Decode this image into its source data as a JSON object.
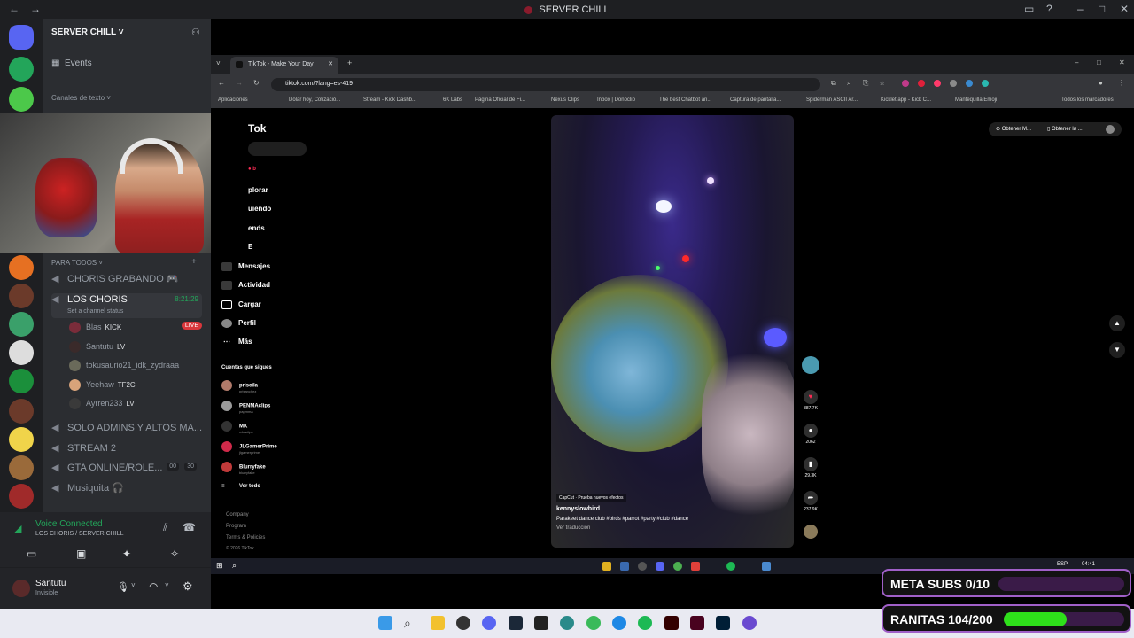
{
  "window": {
    "title": "SERVER CHILL"
  },
  "server": {
    "name": "SERVER CHILL",
    "events_label": "Events",
    "text_channels_label": "Canales de texto",
    "para_todos_label": "PARA TODOS"
  },
  "channels": [
    {
      "name": "CHORIS GRABANDO 🎮",
      "icon": "speaker-icon"
    },
    {
      "name": "LOS CHORIS",
      "icon": "speaker-icon",
      "time": "8:21:29",
      "status": "Set a channel status"
    },
    {
      "name": "SOLO ADMINS Y ALTOS MA...",
      "icon": "speaker-icon"
    },
    {
      "name": "STREAM 2",
      "icon": "speaker-icon"
    },
    {
      "name": "GTA ONLINE/ROLE...",
      "icon": "speaker-icon",
      "counts": [
        "00",
        "30"
      ]
    },
    {
      "name": "Musiquita 🎧",
      "icon": "speaker-icon"
    }
  ],
  "voice_members": [
    {
      "name": "Blas",
      "tag": "KICK",
      "live": "LIVE"
    },
    {
      "name": "Santutu",
      "tag": "LV"
    },
    {
      "name": "tokusaurio21_idk_zydraaa",
      "tag": ""
    },
    {
      "name": "Yeehaw",
      "tag": "TF2C"
    },
    {
      "name": "Ayrren233",
      "tag": "LV"
    }
  ],
  "voice": {
    "status": "Voice Connected",
    "location": "LOS CHORIS / SERVER CHILL"
  },
  "user": {
    "name": "Santutu",
    "status": "Invisible"
  },
  "browser": {
    "tab_title": "TikTok - Make Your Day",
    "url": "tiktok.com/?lang=es-419",
    "bookmarks": [
      "Aplicaciones",
      "Dólar hoy, Cotizació...",
      "Stream - Kick Dashb...",
      "6K Labs",
      "Página Oficial de Fi...",
      "Nexus Clips",
      "Inbox | Donoclip",
      "The best Chatbot an...",
      "Captura de pantalla...",
      "Spiderman ASCII Ar...",
      "Kicklet.app - Kick C...",
      "Mantequilla Emoji",
      "Todos los marcadores"
    ]
  },
  "tiktok": {
    "logo": "Tok",
    "nav": [
      "Explorar",
      "Siguiendo",
      "Friends",
      "Mensajes",
      "Actividad",
      "Cargar",
      "Perfil",
      "Más"
    ],
    "nav_visible": [
      "plorar",
      "uiendo",
      "ends",
      "Mensajes",
      "Actividad",
      "Cargar",
      "Perfil",
      "Más"
    ],
    "following_header": "Cuentas que sigues",
    "following": [
      {
        "name": "priscila",
        "handle": "prisanchez"
      },
      {
        "name": "PENMAclips",
        "handle": "papmma"
      },
      {
        "name": "MK",
        "handle": "mkaclips"
      },
      {
        "name": "JLGamerPrime",
        "handle": "jlgamerprime"
      },
      {
        "name": "Blurryfake",
        "handle": "blurryfake"
      }
    ],
    "see_all": "Ver todo",
    "footer": [
      "Company",
      "Program",
      "Terms & Policies",
      "© 2026 TikTok"
    ],
    "top_buttons": [
      "Obtener M...",
      "Obtener la ..."
    ],
    "video": {
      "capcut": "CapCut · Prueba nuevos efectos",
      "author": "kennyslowbird",
      "caption": "Parakeet dance club #birds #parrot #party #club #dance",
      "translate": "Ver traducción"
    },
    "stats": {
      "likes": "387.7K",
      "comments": "2062",
      "saves": "29.3K",
      "shares": "237.9K"
    }
  },
  "inner_taskbar": {
    "time": "04:41",
    "lang": "ESP"
  },
  "overlays": [
    {
      "label": "META SUBS 0/10",
      "progress": 0.0,
      "color": "#b040e0"
    },
    {
      "label": "RANITAS 104/200",
      "progress": 0.52,
      "color": "#2ee01a"
    }
  ],
  "colors": {
    "discord_bg": "#2b2d31",
    "rail_bg": "#1e1f22",
    "live": "#da373c",
    "voice_green": "#23a55a"
  }
}
